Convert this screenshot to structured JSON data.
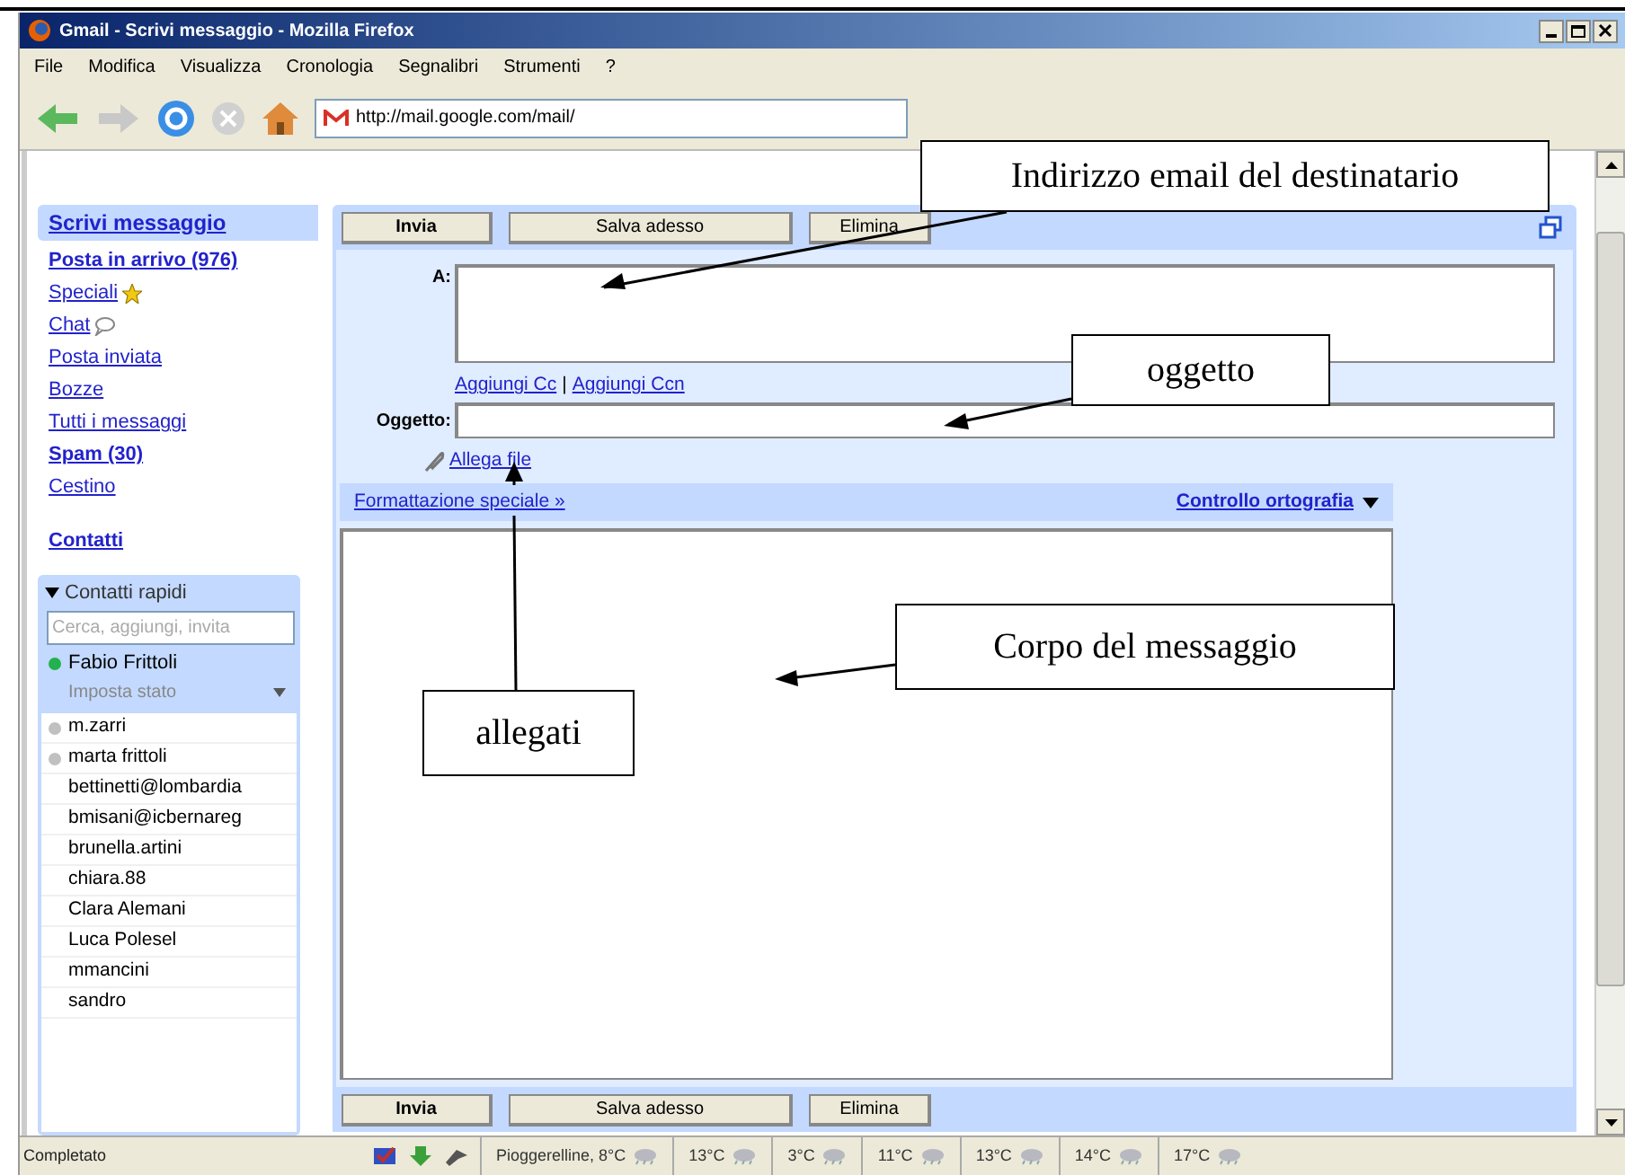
{
  "window": {
    "title": "Gmail - Scrivi messaggio - Mozilla Firefox"
  },
  "menu": [
    "File",
    "Modifica",
    "Visualizza",
    "Cronologia",
    "Segnalibri",
    "Strumenti",
    "?"
  ],
  "address_bar": {
    "value": "http://mail.google.com/mail/"
  },
  "sidebar": {
    "compose": "Scrivi messaggio",
    "items": [
      {
        "label": "Posta in arrivo (976)",
        "unread": true,
        "kind": "plain"
      },
      {
        "label": "Speciali",
        "unread": false,
        "kind": "star"
      },
      {
        "label": "Chat",
        "unread": false,
        "kind": "chat"
      },
      {
        "label": "Posta inviata",
        "unread": false,
        "kind": "plain"
      },
      {
        "label": "Bozze",
        "unread": false,
        "kind": "plain"
      },
      {
        "label": "Tutti i messaggi",
        "unread": false,
        "kind": "plain"
      },
      {
        "label": "Spam (30)",
        "unread": true,
        "kind": "plain"
      },
      {
        "label": "Cestino",
        "unread": false,
        "kind": "plain"
      }
    ],
    "contacts_link": "Contatti",
    "quick_contacts": {
      "title": "Contatti rapidi",
      "expanded": true,
      "search": {
        "placeholder": "Cerca, aggiungi, invita"
      },
      "me": {
        "name": "Fabio Frittoli",
        "color": "#23b14d",
        "status_label": "Imposta stato"
      },
      "contacts": [
        {
          "name": "m.zarri",
          "color": "#c0c0c0"
        },
        {
          "name": "marta frittoli",
          "color": "#c0c0c0"
        },
        {
          "name": "bettinetti@lombardia"
        },
        {
          "name": "bmisani@icbernareg"
        },
        {
          "name": "brunella.artini"
        },
        {
          "name": "chiara.88"
        },
        {
          "name": "Clara Alemani"
        },
        {
          "name": "Luca Polesel"
        },
        {
          "name": "mmancini"
        },
        {
          "name": "sandro"
        }
      ]
    }
  },
  "compose": {
    "top_buttons": [
      "Invia",
      "Salva adesso",
      "Elimina"
    ],
    "to_label": "A:",
    "cc_links": [
      "Aggiungi Cc",
      "Aggiungi Ccn"
    ],
    "cc_separator": "|",
    "subject_label": "Oggetto:",
    "attach": "Allega file",
    "formatting": "Formattazione speciale »",
    "spellcheck": "Controllo ortografia",
    "bottom_buttons": [
      "Invia",
      "Salva adesso",
      "Elimina"
    ]
  },
  "callouts": [
    {
      "text": "Indirizzo email del destinatario"
    },
    {
      "text": "oggetto"
    },
    {
      "text": "Corpo del messaggio"
    },
    {
      "text": "allegati"
    }
  ],
  "status_bar": {
    "text": "Completato",
    "weather": [
      "Pioggerelline, 8°C",
      "13°C",
      "3°C",
      "11°C",
      "13°C",
      "14°C",
      "17°C"
    ]
  }
}
